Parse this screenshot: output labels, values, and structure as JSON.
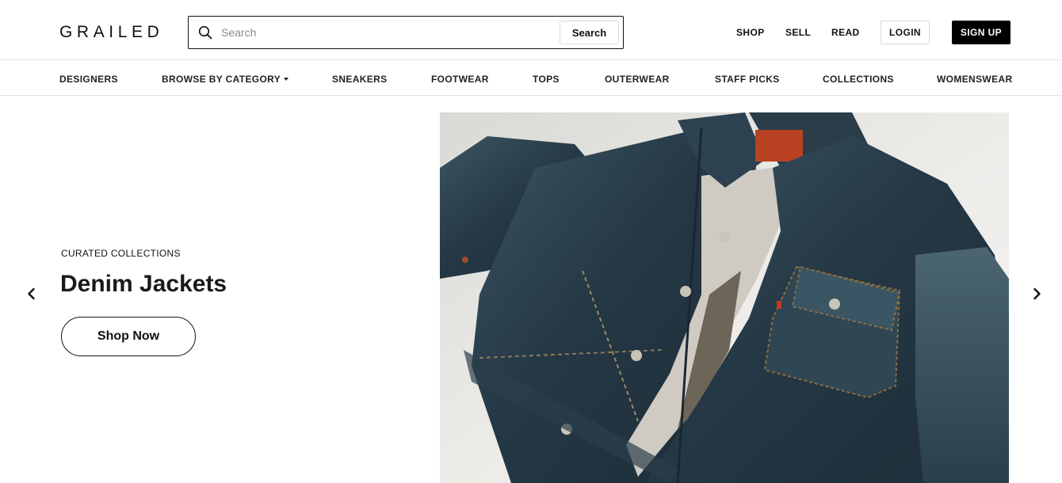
{
  "header": {
    "logo": "GRAILED",
    "search": {
      "placeholder": "Search",
      "value": "",
      "button_label": "Search",
      "icon": "search-icon"
    },
    "links": {
      "shop": "SHOP",
      "sell": "SELL",
      "read": "READ"
    },
    "login_label": "LOGIN",
    "signup_label": "SIGN UP"
  },
  "category_nav": {
    "items": [
      {
        "label": "DESIGNERS"
      },
      {
        "label": "BROWSE BY CATEGORY",
        "has_dropdown": true
      },
      {
        "label": "SNEAKERS"
      },
      {
        "label": "FOOTWEAR"
      },
      {
        "label": "TOPS"
      },
      {
        "label": "OUTERWEAR"
      },
      {
        "label": "STAFF PICKS"
      },
      {
        "label": "COLLECTIONS"
      },
      {
        "label": "WOMENSWEAR"
      }
    ]
  },
  "hero": {
    "eyebrow": "CURATED COLLECTIONS",
    "title": "Denim Jackets",
    "cta_label": "Shop Now",
    "prev_icon": "chevron-left-icon",
    "next_icon": "chevron-right-icon",
    "image": "denim-jacket-photo"
  },
  "colors": {
    "text": "#111111",
    "signup_bg": "#000000",
    "divider": "#e3e3e3",
    "denim_dark": "#22323d",
    "denim_light": "#4a6270"
  }
}
